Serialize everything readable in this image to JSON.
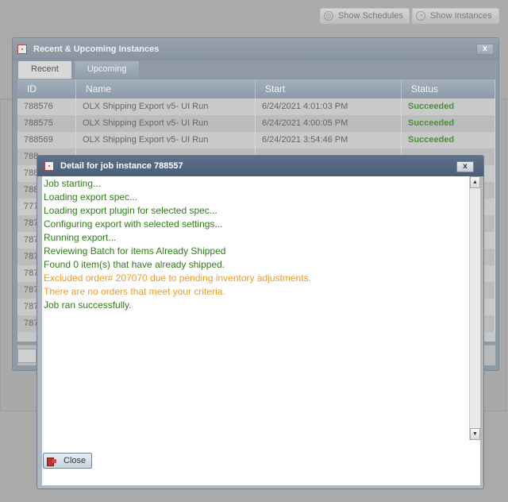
{
  "toolbar": {
    "show_schedules": "Show Schedules",
    "show_instances": "Show Instances"
  },
  "instances_window": {
    "title": "Recent & Upcoming Instances",
    "tabs": [
      {
        "label": "Recent",
        "active": true
      },
      {
        "label": "Upcoming",
        "active": false
      }
    ],
    "columns": [
      "ID",
      "Name",
      "Start",
      "Status"
    ],
    "rows": [
      {
        "id": "788576",
        "name": "OLX Shipping Export v5- UI Run",
        "start": "6/24/2021 4:01:03 PM",
        "status": "Succeeded"
      },
      {
        "id": "788575",
        "name": "OLX Shipping Export v5- UI Run",
        "start": "6/24/2021 4:00:05 PM",
        "status": "Succeeded"
      },
      {
        "id": "788569",
        "name": "OLX Shipping Export v5- UI Run",
        "start": "6/24/2021 3:54:46 PM",
        "status": "Succeeded"
      },
      {
        "id": "788",
        "name": "",
        "start": "",
        "status": ""
      },
      {
        "id": "788",
        "name": "",
        "start": "",
        "status": ""
      },
      {
        "id": "788",
        "name": "",
        "start": "",
        "status": ""
      },
      {
        "id": "777",
        "name": "",
        "start": "",
        "status": ""
      },
      {
        "id": "787",
        "name": "",
        "start": "",
        "status": ""
      },
      {
        "id": "787",
        "name": "",
        "start": "",
        "status": ""
      },
      {
        "id": "787",
        "name": "",
        "start": "",
        "status": ""
      },
      {
        "id": "787",
        "name": "",
        "start": "",
        "status": ""
      },
      {
        "id": "787",
        "name": "",
        "start": "",
        "status": ""
      },
      {
        "id": "787",
        "name": "",
        "start": "",
        "status": ""
      },
      {
        "id": "787",
        "name": "",
        "start": "",
        "status": ""
      }
    ]
  },
  "detail_window": {
    "title": "Detail for job instance 788557",
    "log": [
      {
        "text": "Job starting...",
        "level": "ok"
      },
      {
        "text": "Loading export spec...",
        "level": "ok"
      },
      {
        "text": "Loading export plugin for selected spec...",
        "level": "ok"
      },
      {
        "text": "Configuring export with selected settings...",
        "level": "ok"
      },
      {
        "text": "Running export...",
        "level": "ok"
      },
      {
        "text": "Reviewing Batch for items Already Shipped",
        "level": "ok"
      },
      {
        "text": "Found 0 item(s) that have already shipped.",
        "level": "ok"
      },
      {
        "text": "Excluded order# 207070 due to pending inventory adjustments.",
        "level": "warn"
      },
      {
        "text": "There are no orders that meet your criteria.",
        "level": "warn"
      },
      {
        "text": "Job ran successfully.",
        "level": "ok"
      }
    ],
    "close_label": "Close",
    "close_x": "x"
  },
  "icons": {
    "app": "app-icon",
    "close": "close-icon"
  }
}
